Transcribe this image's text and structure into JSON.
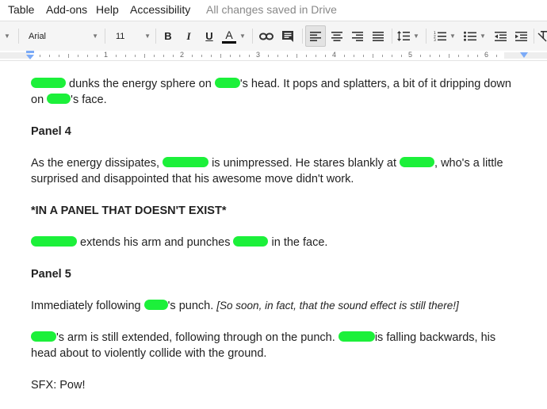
{
  "menu": {
    "items": [
      "Table",
      "Add-ons",
      "Help",
      "Accessibility"
    ],
    "status": "All changes saved in Drive"
  },
  "toolbar": {
    "font": "Arial",
    "size": "11",
    "bold": "B",
    "italic": "I",
    "underline": "U",
    "text_color": "A",
    "text_color_underline": "#000000"
  },
  "ruler": {
    "numbers": [
      "1",
      "2",
      "3",
      "4",
      "5",
      "6"
    ]
  },
  "document": {
    "redaction_color": "#1cf03a",
    "lines": [
      {
        "type": "text",
        "parts": [
          "",
          " dunks the energy sphere on ",
          "",
          "'s head. It pops and splatters, a bit of it dripping down"
        ]
      },
      {
        "type": "text",
        "parts": [
          "on ",
          "",
          "'s face."
        ]
      },
      {
        "type": "heading",
        "text": "Panel 4"
      },
      {
        "type": "text",
        "parts": [
          "As the energy dissipates, ",
          "",
          " is unimpressed. He stares blankly at ",
          "",
          ", who's a little"
        ]
      },
      {
        "type": "text",
        "parts": [
          "surprised and disappointed that his awesome move didn't work."
        ]
      },
      {
        "type": "heading",
        "text": "*IN A PANEL THAT DOESN'T EXIST*"
      },
      {
        "type": "text",
        "parts": [
          "",
          " extends his arm and punches ",
          "",
          " in the face."
        ]
      },
      {
        "type": "heading",
        "text": "Panel 5"
      },
      {
        "type": "text",
        "parts": [
          "Immediately following ",
          "",
          "'s punch. ",
          "[So soon, in fact, that the sound effect is still there!]"
        ]
      },
      {
        "type": "text",
        "parts": [
          "",
          "'s arm is still extended, following through on the punch. ",
          "",
          "is falling backwards, his"
        ]
      },
      {
        "type": "text",
        "parts": [
          "head about to violently collide with the ground."
        ]
      },
      {
        "type": "text",
        "parts": [
          "SFX: Pow!"
        ]
      }
    ]
  }
}
